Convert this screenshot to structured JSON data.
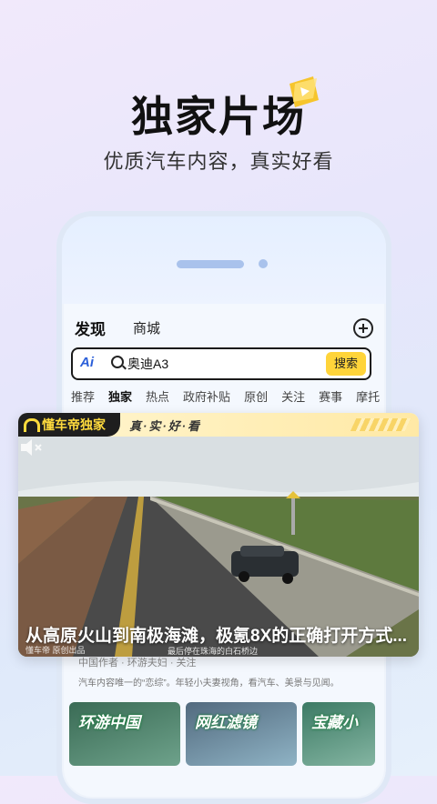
{
  "hero": {
    "title": "独家片场",
    "subtitle": "优质汽车内容，真实好看"
  },
  "app": {
    "tabs": [
      "发现",
      "商城"
    ],
    "search": {
      "ai_label": "Ai",
      "query": "奥迪A3",
      "button": "搜索"
    },
    "channels": [
      "推荐",
      "独家",
      "热点",
      "政府补贴",
      "原创",
      "关注",
      "赛事",
      "摩托"
    ]
  },
  "video_card": {
    "brand": "懂车帝独家",
    "slogan": "真·实·好·看",
    "caption": "从高原火山到南极海滩，极氪8X的正确打开方式...",
    "watermark": "懂车帝 原创出品",
    "location": "最后停在珠海的白石桥边"
  },
  "behind": {
    "meta": "中国作者 · 环游夫妇 · 关注",
    "desc": "汽车内容唯一的“恋综”。年轻小夫妻视角，看汽车、美景与见闻。",
    "tiles": [
      "环游中国",
      "网红滤镜",
      "宝藏小"
    ]
  },
  "colors": {
    "accent": "#ffd43a",
    "brand_dark": "#1e1e1e",
    "ai_blue": "#2b5fd9"
  }
}
